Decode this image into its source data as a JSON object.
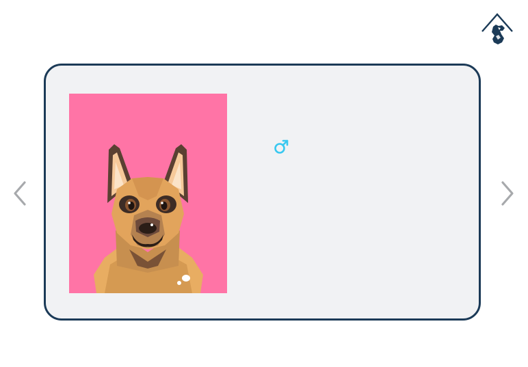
{
  "logo": {
    "icon": "house-dog-logo-icon"
  },
  "card": {
    "photo": {
      "icon": "german-shepherd-dog-illustration"
    },
    "gender": {
      "icon": "male-symbol-icon",
      "symbol": "♂"
    }
  },
  "nav": {
    "prev_icon": "chevron-left-icon",
    "next_icon": "chevron-right-icon"
  },
  "colors": {
    "card_border": "#1b3a57",
    "card_background": "#f1f2f4",
    "photo_background": "#ff74a6",
    "gender_accent": "#39c8f0",
    "nav_arrow": "#a7a9ac",
    "logo": "#1b3a57"
  }
}
